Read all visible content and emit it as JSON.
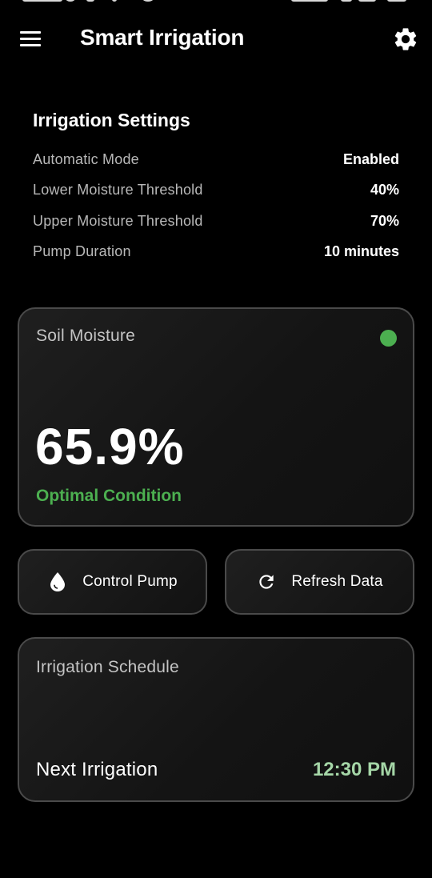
{
  "app_bar": {
    "title": "Smart Irrigation",
    "menu_icon": "hamburger-menu-icon",
    "settings_icon": "gear-icon"
  },
  "settings": {
    "title": "Irrigation Settings",
    "rows": [
      {
        "label": "Automatic Mode",
        "value": "Enabled"
      },
      {
        "label": "Lower Moisture Threshold",
        "value": "40%"
      },
      {
        "label": "Upper Moisture Threshold",
        "value": "70%"
      },
      {
        "label": "Pump Duration",
        "value": "10 minutes"
      }
    ]
  },
  "moisture": {
    "title": "Soil Moisture",
    "value": "65.9%",
    "condition": "Optimal Condition",
    "status_color": "#4caf50"
  },
  "actions": {
    "pump": {
      "label": "Control Pump",
      "icon": "water-drop-icon"
    },
    "refresh": {
      "label": "Refresh Data",
      "icon": "refresh-icon"
    }
  },
  "schedule": {
    "title": "Irrigation Schedule",
    "next_label": "Next Irrigation",
    "next_time": "12:30 PM",
    "time_color": "#a5d6a7"
  },
  "colors": {
    "background": "#000000",
    "card_border": "#4a4a4a",
    "accent_green": "#4caf50"
  }
}
